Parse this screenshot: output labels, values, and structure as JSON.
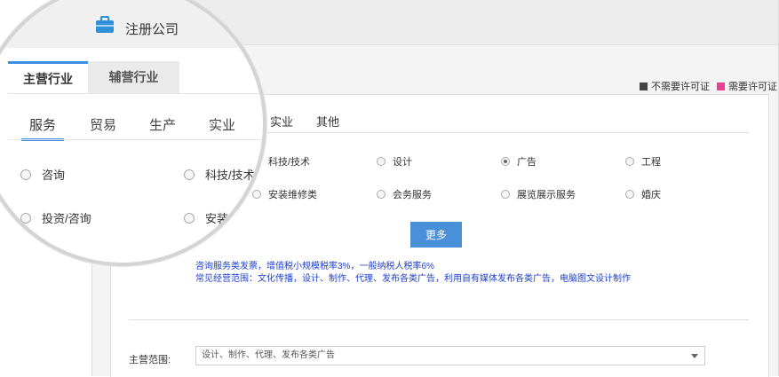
{
  "header": {
    "title": "注册公司"
  },
  "legend": {
    "no_license": "不需要许可证",
    "need_license": "需要许可证",
    "no_license_color": "#444444",
    "need_license_color": "#e84393"
  },
  "tabs": {
    "main": "主营行业",
    "secondary": "辅营行业"
  },
  "categories": [
    "服务",
    "贸易",
    "生产",
    "实业",
    "其他"
  ],
  "options": {
    "row1": [
      "咨询",
      "科技/技术",
      "设计",
      "广告",
      "工程"
    ],
    "row2": [
      "投资/咨询",
      "安装维修类",
      "会务服务",
      "展览展示服务",
      "婚庆"
    ],
    "selected": "广告"
  },
  "more_button": "更多",
  "notes": {
    "line1": "咨询服务类发票，增值税小规模税率3%，一般纳税人税率6%",
    "line2": "常见经营范围：文化传播，设计、制作、代理、发布各类广告，利用自有媒体发布各类广告，电脑图文设计制作"
  },
  "scope": {
    "label": "主营范围:",
    "value": "设计、制作、代理、发布各类广告"
  },
  "magnifier": {
    "title": "注册公司",
    "tab_main": "主营行业",
    "tab_sub": "辅营行业",
    "categories": [
      "服务",
      "贸易",
      "生产",
      "实业"
    ],
    "row1": [
      "咨询",
      "科技/技术"
    ],
    "row2": [
      "投资/咨询",
      "安装维"
    ]
  }
}
